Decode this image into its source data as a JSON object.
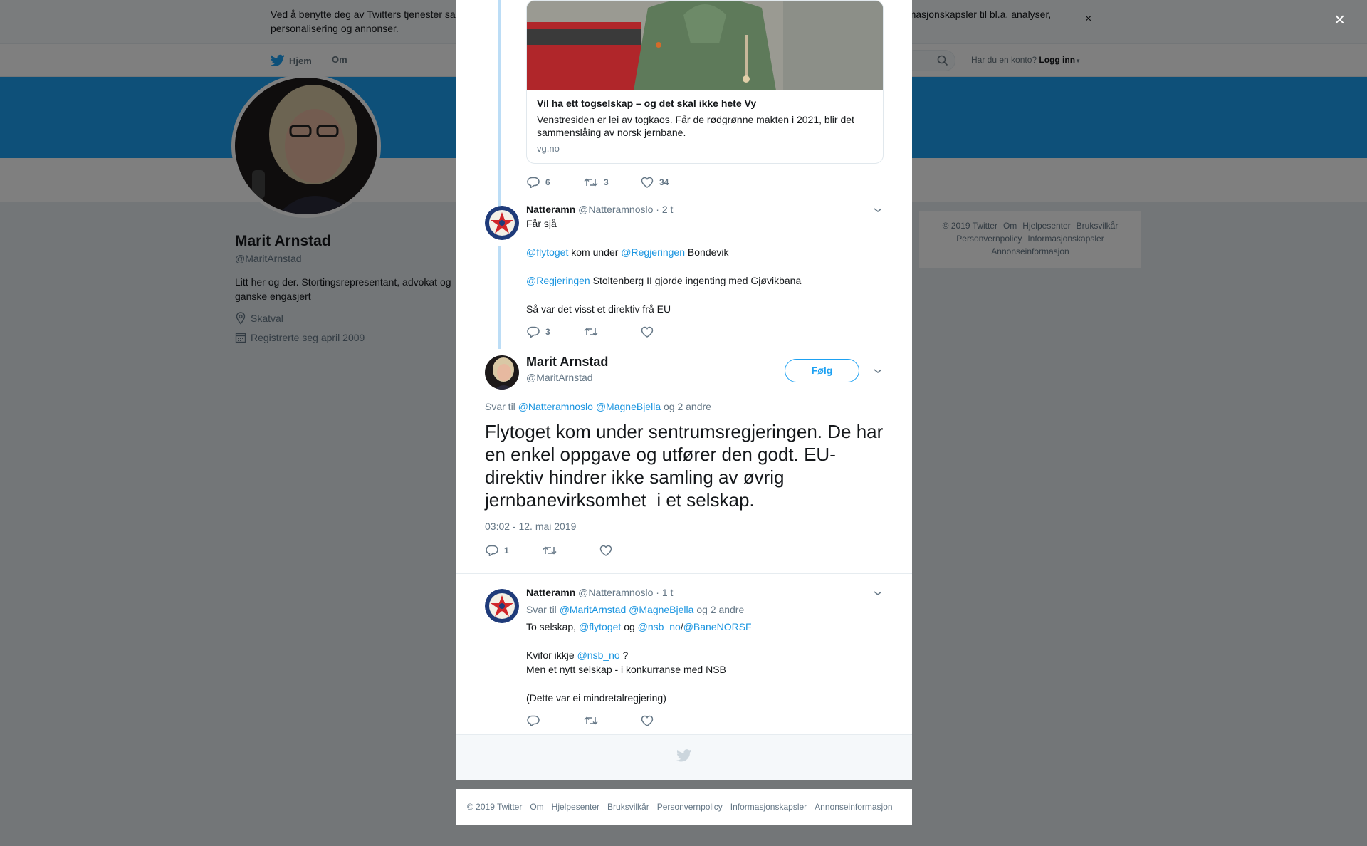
{
  "cookie": {
    "text_left": "Ved å benytte deg av Twitters tjenester sa",
    "text_right": "informasjonskapsler til bl.a. analyser,",
    "text_line2": "personalisering og annonser.",
    "close": "×"
  },
  "nav": {
    "home": "Hjem",
    "about": "Om",
    "account_prompt": "Har du en konto?",
    "login": "Logg inn"
  },
  "profile": {
    "name": "Marit Arnstad",
    "handle": "@MaritArnstad",
    "bio": "Litt her og der. Stortingsrepresentant, advokat og ganske engasjert",
    "location": "Skatval",
    "joined": "Registrerte seg april 2009"
  },
  "side_footer": {
    "line1": [
      "© 2019 Twitter",
      "Om",
      "Hjelpesenter",
      "Bruksvilkår"
    ],
    "line2": [
      "Personvernpolicy",
      "Informasjonskapsler"
    ],
    "line3": [
      "Annonseinformasjon"
    ]
  },
  "overlay_close": "×",
  "card": {
    "title": "Vil ha ett togselskap – og det skal ikke hete Vy",
    "description": "Venstresiden er lei av togkaos. Får de rødgrønne makten i 2021, blir det sammenslåing av norsk jernbane.",
    "domain": "vg.no"
  },
  "tweet1_actions": {
    "replies": "6",
    "retweets": "3",
    "likes": "34"
  },
  "tweet2": {
    "name": "Natteramn",
    "handle": "@Natteramnoslo",
    "time": "· 2 t",
    "line1": "Får sjå",
    "mention_flytoget": "@flytoget",
    "text_kom_under": "kom under",
    "mention_regjeringen": "@Regjeringen",
    "text_bondevik": "Bondevik",
    "mention_regjeringen2": "@Regjeringen",
    "text_stoltenberg": "Stoltenberg II gjorde ingenting med Gjøvikbana",
    "line_eu": "Så var det visst et direktiv frå EU",
    "replies": "3"
  },
  "main_tweet": {
    "name": "Marit Arnstad",
    "handle": "@MaritArnstad",
    "follow": "Følg",
    "reply_to_label": "Svar til",
    "reply_to_1": "@Natteramnoslo",
    "reply_to_2": "@MagneBjella",
    "reply_to_more": "og 2 andre",
    "text": "Flytoget kom under sentrumsregjeringen. De har en enkel oppgave og utfører den godt. EU-direktiv hindrer ikke samling av øvrig jernbanevirksomhet  i et selskap.",
    "timestamp": "03:02 - 12. mai 2019",
    "replies": "1"
  },
  "tweet3": {
    "name": "Natteramn",
    "handle": "@Natteramnoslo",
    "time": "· 1 t",
    "reply_to_label": "Svar til",
    "reply_to_1": "@MaritArnstad",
    "reply_to_2": "@MagneBjella",
    "reply_to_more": "og 2 andre",
    "text_to": "To selskap,",
    "mention_flytoget": "@flytoget",
    "text_og": "og",
    "mention_nsb": "@nsb_no",
    "text_slash": "/",
    "mention_banenor": "@BaneNORSF",
    "text_kvifor": "Kvifor ikkje",
    "mention_nsb2": "@nsb_no",
    "text_q": "?",
    "line_men": "Men et nytt selskap - i  konkurranse med NSB",
    "line_dette": "(Dette var ei mindretalregjering)"
  },
  "bottom_footer": [
    "© 2019 Twitter",
    "Om",
    "Hjelpesenter",
    "Bruksvilkår",
    "Personvernpolicy",
    "Informasjonskapsler",
    "Annonseinformasjon"
  ],
  "colors": {
    "brand": "#1da1f2",
    "link": "#1b95e0",
    "thread": "#bcddf6"
  },
  "icons": [
    "twitter-bird-icon",
    "search-icon",
    "location-icon",
    "calendar-icon",
    "reply-icon",
    "retweet-icon",
    "like-icon",
    "chevron-down-icon",
    "close-icon"
  ]
}
